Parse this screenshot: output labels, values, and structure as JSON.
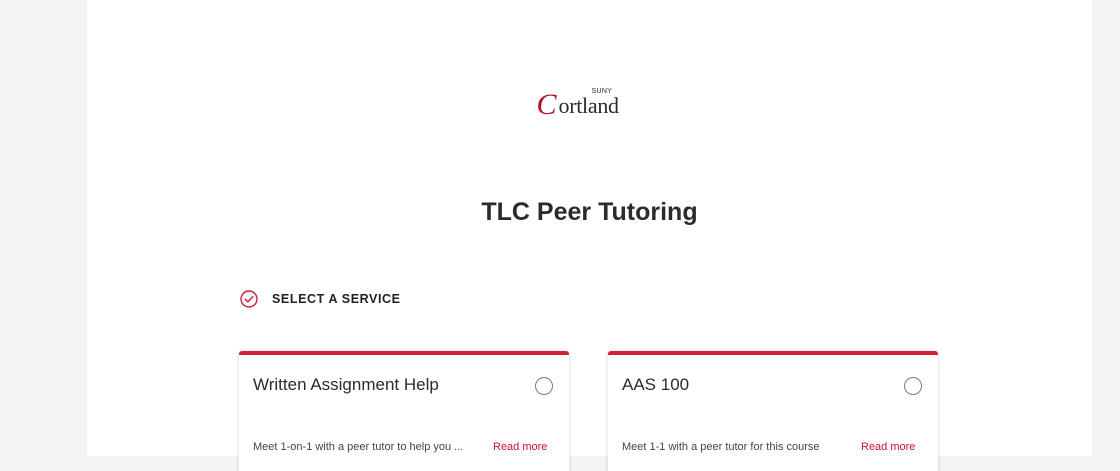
{
  "logo": {
    "initial": "C",
    "rest": "ortland",
    "suny": "SUNY"
  },
  "page_title": "TLC Peer Tutoring",
  "step": {
    "label": "SELECT A SERVICE"
  },
  "services": [
    {
      "title": "Written Assignment Help",
      "description": "Meet 1-on-1 with a peer tutor to help you ...",
      "read_more": "Read more"
    },
    {
      "title": "AAS 100",
      "description": "Meet 1-1 with a peer tutor for this course",
      "read_more": "Read more"
    }
  ],
  "colors": {
    "accent": "#d11f34",
    "brand": "#b0121f",
    "link": "#c8102e"
  }
}
